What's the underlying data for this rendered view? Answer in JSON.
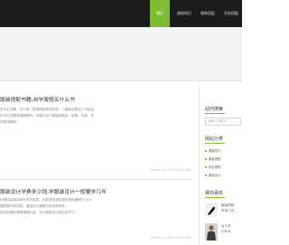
{
  "nav": {
    "items": [
      {
        "label": "首页",
        "active": true
      },
      {
        "label": "服装知识",
        "active": false
      },
      {
        "label": "服装搭配",
        "active": false
      },
      {
        "label": "色彩搭配",
        "active": false
      }
    ]
  },
  "posts": [
    {
      "title": "服装搭配书籍,自学服搭买什么书",
      "lines": [
        "本文由书籍，总下是一些搭和推荐的选项：《服装学概论》内容全",
        "年学生的基础课程教材，详细介绍了服装的概念、起源、构成、历",
        "学等领域知"
      ],
      "meta": "Posted on 2023-04-00   Buy"
    },
    {
      "title": "服装设计学费多少钱,学服装设计一般要学几年",
      "lines": [
        "的费用由培训机构不同而异，优质学校或机构的费用通常在 元以",
        "要根据学费选择。服装设计课程中培训机构有...",
        "报名前要弄清楚课程内容。对于服装设计培训的学习..."
      ],
      "meta": "Posted on 2023-04-00   Buy"
    }
  ],
  "sidebar": {
    "search_title": "站内搜索",
    "search_placeholder": "请输入关键字",
    "category_title": "网站分类",
    "categories": [
      "服装知识",
      "服装搭配",
      "色彩搭配",
      "服装设计"
    ],
    "hot_title": "猜你喜欢",
    "hot_items": [
      {
        "lines": [
          "服装搭配",
          "学多少钱"
        ]
      },
      {
        "lines": [
          "女人衣",
          "中年女"
        ]
      }
    ]
  },
  "colors": {
    "accent": "#7dbb2f",
    "topbar": "#1b1b1b"
  }
}
